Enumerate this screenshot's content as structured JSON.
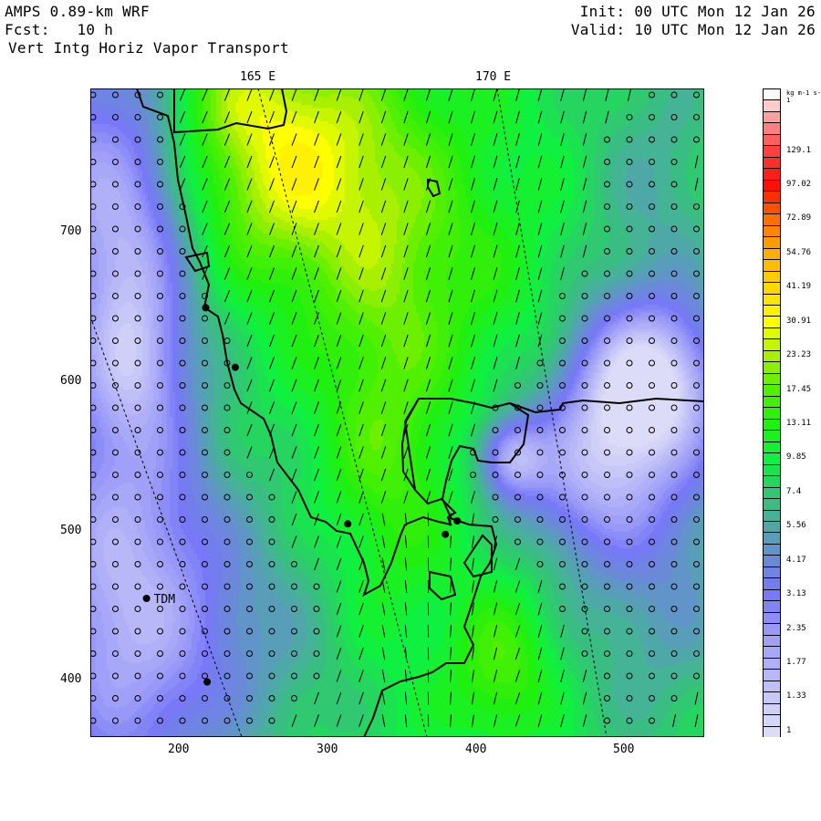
{
  "header": {
    "model": "AMPS 0.89-km WRF",
    "forecast": "Fcst:   10 h",
    "field": "Vert Intg Horiz Vapor Transport",
    "init": "Init: 00 UTC Mon 12 Jan 26",
    "valid": "Valid: 10 UTC Mon 12 Jan 26"
  },
  "map": {
    "longitude_labels": [
      "165 E",
      "170 E"
    ],
    "x_ticks": [
      "200",
      "300",
      "400",
      "500"
    ],
    "y_ticks": [
      "700",
      "600",
      "500",
      "400"
    ],
    "x_range": [
      140,
      555
    ],
    "y_range": [
      360,
      795
    ],
    "stations": [
      {
        "x": 218,
        "y": 648,
        "label": ""
      },
      {
        "x": 238,
        "y": 608,
        "label": ""
      },
      {
        "x": 314,
        "y": 503,
        "label": ""
      },
      {
        "x": 380,
        "y": 496,
        "label": ""
      },
      {
        "x": 388,
        "y": 505,
        "label": ""
      },
      {
        "x": 178,
        "y": 453,
        "label": "TDM"
      },
      {
        "x": 219,
        "y": 397,
        "label": ""
      }
    ]
  },
  "colorbar": {
    "units": "kg m-1 s-1",
    "labels": [
      "1",
      "1.33",
      "1.77",
      "2.35",
      "3.13",
      "4.17",
      "5.56",
      "7.4",
      "9.85",
      "13.11",
      "17.45",
      "23.23",
      "30.91",
      "41.19",
      "54.76",
      "72.89",
      "97.02",
      "129.1"
    ],
    "color_anchors": [
      "#dcdcf8",
      "#c8c8f8",
      "#b0b0f8",
      "#9898f8",
      "#7878f8",
      "#6a8ad8",
      "#4fa8a8",
      "#30c870",
      "#10f040",
      "#20f010",
      "#50f000",
      "#a8f000",
      "#ffff00",
      "#ffd800",
      "#ffb000",
      "#ff7000",
      "#ff1000",
      "#ff4040",
      "#ffa0a0",
      "#fff8f8"
    ]
  }
}
